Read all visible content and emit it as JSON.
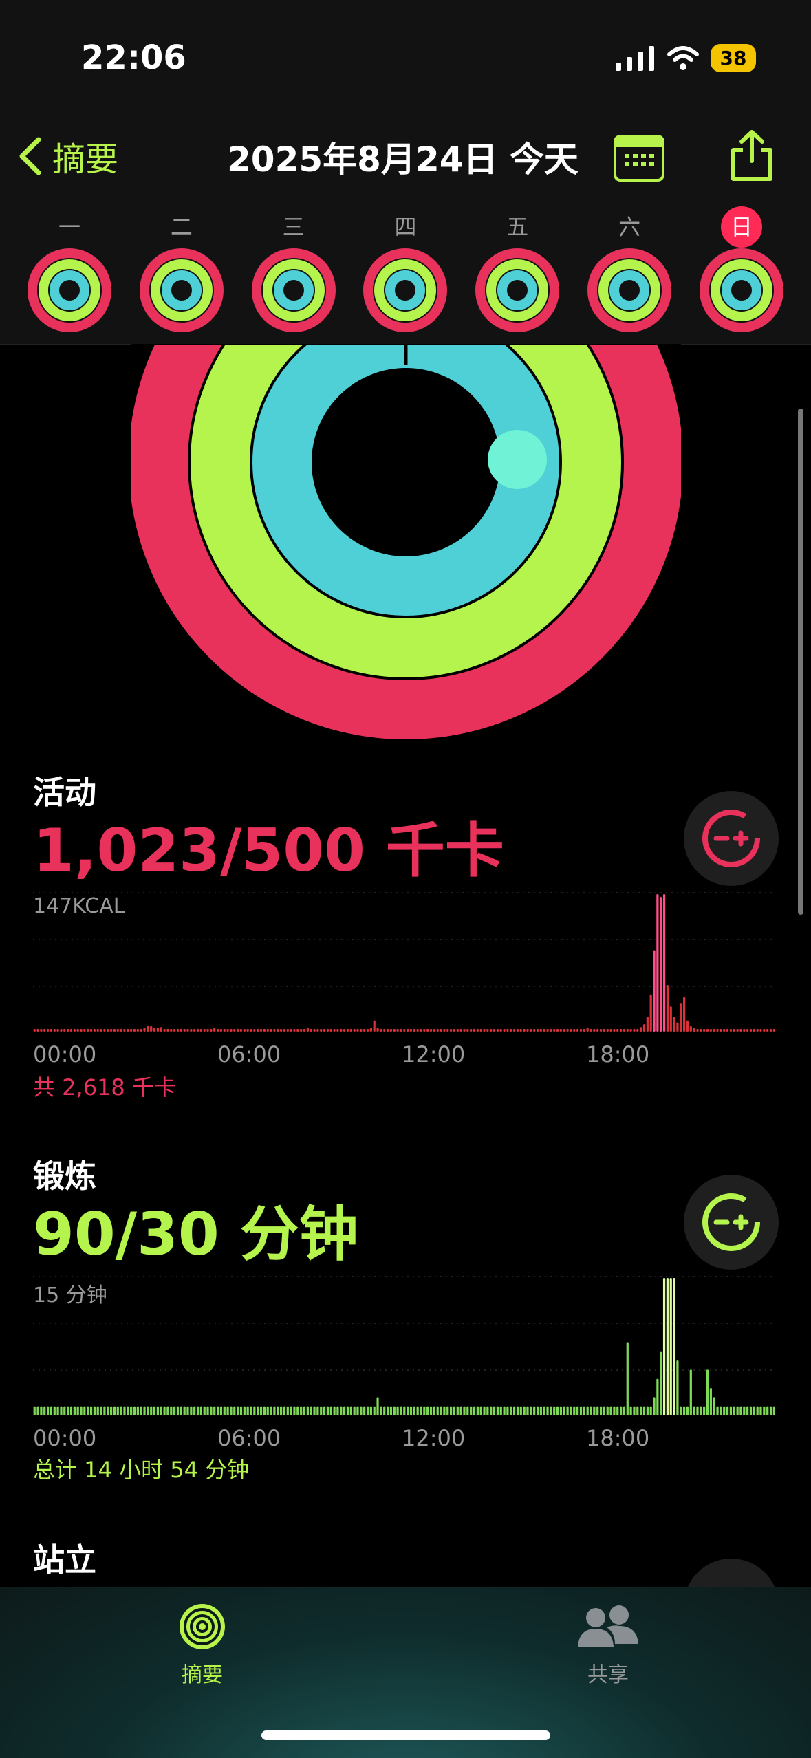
{
  "status": {
    "time": "22:06",
    "battery": "38"
  },
  "header": {
    "back_label": "摘要",
    "date": "2025年8月24日 今天"
  },
  "week": [
    {
      "label": "一"
    },
    {
      "label": "二"
    },
    {
      "label": "三"
    },
    {
      "label": "四"
    },
    {
      "label": "五"
    },
    {
      "label": "六"
    },
    {
      "label": "日",
      "today": true
    }
  ],
  "colors": {
    "move": "#e8315b",
    "exercise": "#b4f44c",
    "stand": "#4fd0d6",
    "accent": "#b7f34a"
  },
  "move": {
    "title": "活动",
    "value": "1,023/500 千卡",
    "chart_top": "147KCAL",
    "total": "共 2,618 千卡",
    "ticks": [
      "00:00",
      "06:00",
      "12:00",
      "18:00"
    ]
  },
  "exercise": {
    "title": "锻炼",
    "value": "90/30 分钟",
    "chart_top": "15 分钟",
    "total": "总计 14 小时 54 分钟",
    "ticks": [
      "00:00",
      "06:00",
      "12:00",
      "18:00"
    ]
  },
  "stand": {
    "title": "站立"
  },
  "tabs": [
    {
      "label": "摘要",
      "icon": "activity-rings-icon",
      "active": true
    },
    {
      "label": "共享",
      "icon": "people-icon",
      "active": false
    }
  ],
  "chart_data": [
    {
      "type": "bar",
      "title": "",
      "xlabel": "",
      "ylabel": "",
      "ylim": [
        0,
        147
      ],
      "x_ticks": [
        "00:00",
        "06:00",
        "12:00",
        "18:00"
      ],
      "values": [
        3,
        3,
        3,
        3,
        3,
        3,
        3,
        3,
        3,
        3,
        3,
        3,
        3,
        3,
        3,
        3,
        3,
        3,
        3,
        3,
        3,
        3,
        3,
        3,
        3,
        3,
        3,
        3,
        3,
        3,
        3,
        3,
        3,
        4,
        6,
        6,
        4,
        4,
        5,
        3,
        3,
        3,
        3,
        3,
        3,
        3,
        3,
        3,
        3,
        3,
        3,
        3,
        3,
        3,
        4,
        3,
        3,
        3,
        3,
        3,
        3,
        3,
        3,
        3,
        3,
        3,
        3,
        3,
        3,
        3,
        3,
        3,
        3,
        3,
        3,
        3,
        3,
        3,
        3,
        3,
        3,
        3,
        4,
        3,
        3,
        3,
        3,
        3,
        3,
        3,
        3,
        3,
        3,
        3,
        3,
        3,
        3,
        3,
        3,
        3,
        3,
        4,
        12,
        4,
        3,
        3,
        3,
        3,
        3,
        3,
        3,
        3,
        3,
        3,
        3,
        3,
        3,
        3,
        3,
        3,
        3,
        3,
        3,
        3,
        3,
        3,
        3,
        3,
        3,
        3,
        3,
        3,
        3,
        3,
        3,
        3,
        3,
        3,
        3,
        3,
        3,
        3,
        3,
        3,
        3,
        3,
        3,
        3,
        3,
        3,
        3,
        3,
        3,
        3,
        3,
        3,
        3,
        3,
        3,
        3,
        3,
        3,
        3,
        3,
        3,
        3,
        4,
        3,
        3,
        3,
        3,
        3,
        3,
        3,
        3,
        3,
        3,
        3,
        3,
        3,
        3,
        3,
        5,
        8,
        16,
        40,
        87,
        147,
        144,
        147,
        50,
        27,
        16,
        10,
        30,
        37,
        12,
        6,
        4,
        3,
        3,
        3,
        3,
        3,
        3,
        3,
        3,
        3,
        3,
        3,
        3,
        3,
        3,
        3,
        3,
        3,
        3,
        3,
        3,
        3,
        3,
        3,
        3
      ]
    },
    {
      "type": "bar",
      "title": "",
      "xlabel": "",
      "ylabel": "",
      "ylim": [
        0,
        15
      ],
      "x_ticks": [
        "00:00",
        "06:00",
        "12:00",
        "18:00"
      ],
      "values": [
        1,
        1,
        1,
        1,
        1,
        1,
        1,
        1,
        1,
        1,
        1,
        1,
        1,
        1,
        1,
        1,
        1,
        1,
        1,
        1,
        1,
        1,
        1,
        1,
        1,
        1,
        1,
        1,
        1,
        1,
        1,
        1,
        1,
        1,
        1,
        1,
        1,
        1,
        1,
        1,
        1,
        1,
        1,
        1,
        1,
        1,
        1,
        1,
        1,
        1,
        1,
        1,
        1,
        1,
        1,
        1,
        1,
        1,
        1,
        1,
        1,
        1,
        1,
        1,
        1,
        1,
        1,
        1,
        1,
        1,
        1,
        1,
        1,
        1,
        1,
        1,
        1,
        1,
        1,
        1,
        1,
        1,
        1,
        1,
        1,
        1,
        1,
        1,
        1,
        1,
        1,
        1,
        1,
        1,
        1,
        1,
        1,
        1,
        1,
        1,
        1,
        1,
        1,
        2,
        1,
        1,
        1,
        1,
        1,
        1,
        1,
        1,
        1,
        1,
        1,
        1,
        1,
        1,
        1,
        1,
        1,
        1,
        1,
        1,
        1,
        1,
        1,
        1,
        1,
        1,
        1,
        1,
        1,
        1,
        1,
        1,
        1,
        1,
        1,
        1,
        1,
        1,
        1,
        1,
        1,
        1,
        1,
        1,
        1,
        1,
        1,
        1,
        1,
        1,
        1,
        1,
        1,
        1,
        1,
        1,
        1,
        1,
        1,
        1,
        1,
        1,
        1,
        1,
        1,
        1,
        1,
        1,
        1,
        1,
        1,
        1,
        1,
        1,
        8,
        1,
        1,
        1,
        1,
        1,
        1,
        1,
        2,
        4,
        7,
        15,
        15,
        15,
        15,
        6,
        1,
        1,
        1,
        5,
        1,
        1,
        1,
        1,
        5,
        3,
        2,
        1,
        1,
        1,
        1,
        1,
        1,
        1,
        1,
        1,
        1,
        1,
        1,
        1,
        1,
        1,
        1,
        1,
        1
      ]
    }
  ]
}
